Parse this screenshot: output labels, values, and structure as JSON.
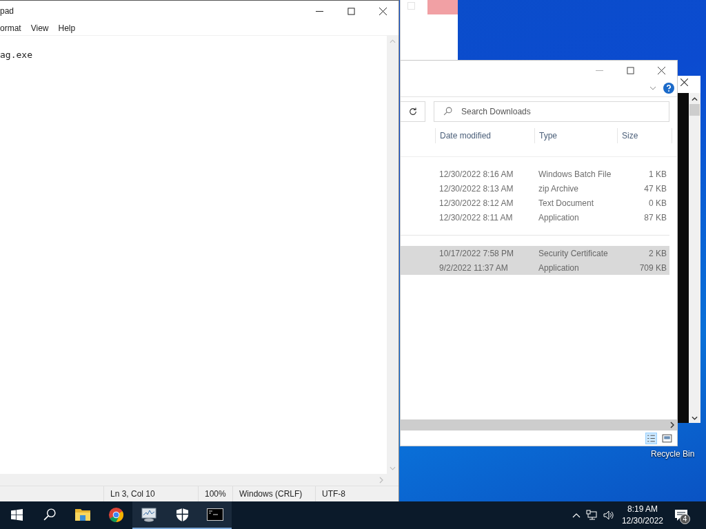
{
  "notepad": {
    "title": "pad",
    "menu": [
      "ormat",
      "View",
      "Help"
    ],
    "text": "ag.exe",
    "status": [
      "Ln 3, Col 10",
      "100%",
      "Windows (CRLF)",
      "UTF-8"
    ]
  },
  "explorer": {
    "search": {
      "placeholder": "Search Downloads"
    },
    "columns": [
      "Date modified",
      "Type",
      "Size"
    ],
    "groups": [
      {
        "rows": [
          {
            "date": "12/30/2022 8:16 AM",
            "type": "Windows Batch File",
            "size": "1 KB",
            "selected": false
          },
          {
            "date": "12/30/2022 8:13 AM",
            "type": "zip Archive",
            "size": "47 KB",
            "selected": false
          },
          {
            "date": "12/30/2022 8:12 AM",
            "type": "Text Document",
            "size": "0 KB",
            "selected": false
          },
          {
            "date": "12/30/2022 8:11 AM",
            "type": "Application",
            "size": "87 KB",
            "selected": false
          }
        ]
      },
      {
        "rows": [
          {
            "date": "10/17/2022 7:58 PM",
            "type": "Security Certificate",
            "size": "2 KB",
            "selected": true
          },
          {
            "date": "9/2/2022 11:37 AM",
            "type": "Application",
            "size": "709 KB",
            "selected": true
          }
        ]
      }
    ]
  },
  "desktop": {
    "icon_label": "Recycle Bin"
  },
  "taskbar": {
    "apps": [
      {
        "kind": "folder",
        "running": false
      },
      {
        "kind": "chrome",
        "running": false
      },
      {
        "kind": "monitor",
        "running": true
      },
      {
        "kind": "shield",
        "running": true
      },
      {
        "kind": "console",
        "running": true
      }
    ],
    "time": "8:19 AM",
    "date": "12/30/2022",
    "notifications": "4"
  }
}
